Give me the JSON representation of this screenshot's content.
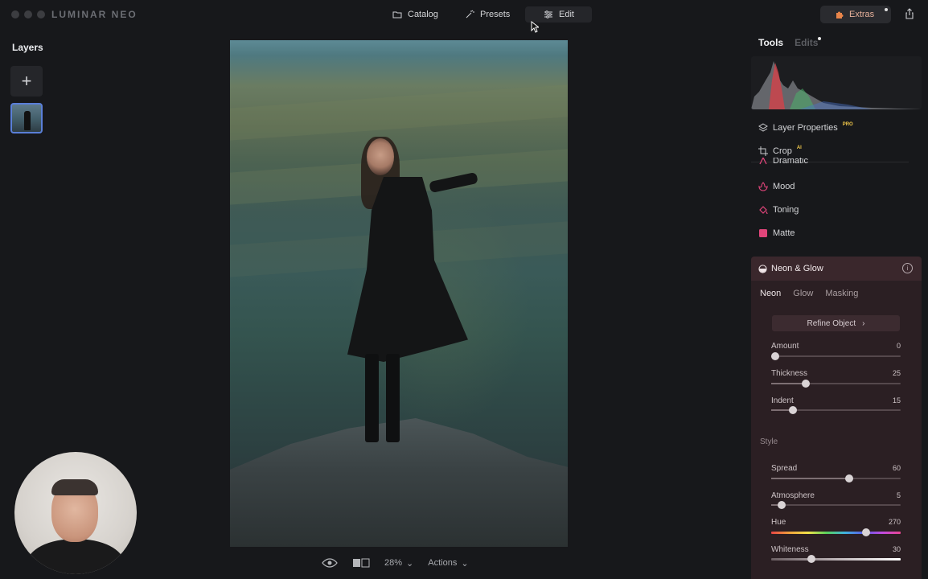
{
  "app": {
    "brand": "LUMINAR",
    "brand_suffix": "NEO"
  },
  "nav": {
    "catalog": "Catalog",
    "presets": "Presets",
    "edit": "Edit",
    "extras": "Extras"
  },
  "layers": {
    "title": "Layers",
    "add_glyph": "+"
  },
  "bottom_toolbar": {
    "zoom": "28%",
    "actions": "Actions"
  },
  "right_panel": {
    "tabs": {
      "tools": "Tools",
      "edits": "Edits"
    },
    "tools": [
      {
        "label": "Layer Properties",
        "badge": "PRO",
        "icon": "layers-icon",
        "color": "#c9cacd"
      },
      {
        "label": "Crop",
        "badge": "AI",
        "icon": "crop-icon",
        "color": "#c9cacd"
      },
      {
        "label": "Dramatic",
        "icon": "dramatic-icon",
        "color": "#e0457a"
      },
      {
        "label": "Mood",
        "icon": "mood-icon",
        "color": "#e0457a"
      },
      {
        "label": "Toning",
        "icon": "toning-icon",
        "color": "#e0457a"
      },
      {
        "label": "Matte",
        "icon": "matte-icon",
        "color": "#e0457a"
      }
    ],
    "neon_glow": {
      "title": "Neon & Glow",
      "info_glyph": "i",
      "tabs": [
        "Neon",
        "Glow",
        "Masking"
      ],
      "refine_button": "Refine Object",
      "style_label": "Style",
      "sliders": [
        {
          "label": "Amount",
          "value": "0",
          "fraction": 0.03
        },
        {
          "label": "Thickness",
          "value": "25",
          "fraction": 0.27
        },
        {
          "label": "Indent",
          "value": "15",
          "fraction": 0.17
        },
        {
          "label": "Spread",
          "value": "60",
          "fraction": 0.6
        },
        {
          "label": "Atmosphere",
          "value": "5",
          "fraction": 0.08
        },
        {
          "label": "Hue",
          "value": "270",
          "fraction": 0.73
        },
        {
          "label": "Whiteness",
          "value": "30",
          "fraction": 0.31
        }
      ]
    }
  },
  "colors": {
    "accent": "#5a7fd8",
    "tool_icon_pink": "#e0457a",
    "extras_text": "#e6b09a",
    "panel_bg": "#2b1f23"
  }
}
